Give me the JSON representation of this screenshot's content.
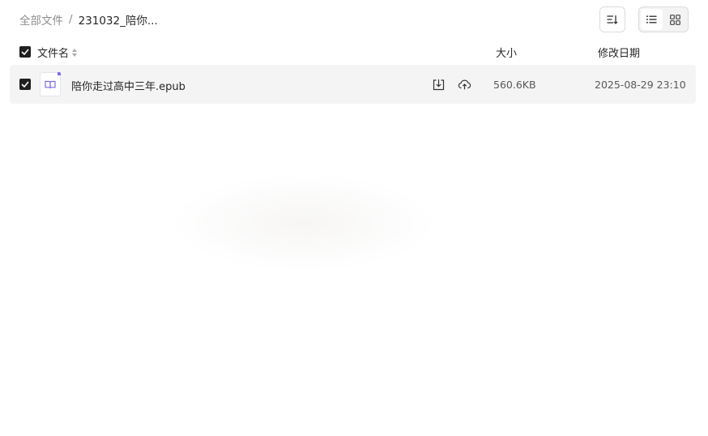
{
  "breadcrumb": {
    "root": "全部文件",
    "separator": "/",
    "current": "231032_陪你..."
  },
  "toolbar": {
    "sort_icon": "sort-descending-icon",
    "view_modes": [
      {
        "name": "list",
        "icon": "list-icon",
        "active": true
      },
      {
        "name": "grid",
        "icon": "grid-icon",
        "active": false
      }
    ]
  },
  "table": {
    "columns": {
      "name": "文件名",
      "size": "大小",
      "date": "修改日期"
    },
    "rows": [
      {
        "name": "陪你走过高中三年.epub",
        "icon": "epub-book-icon",
        "size": "560.6KB",
        "modified": "2025-08-29 23:10",
        "checked": true,
        "actions": [
          "download-icon",
          "cloud-save-icon"
        ]
      }
    ]
  },
  "colors": {
    "accent": "#7c6ee6",
    "row_bg": "#f4f4f4",
    "checkbox": "#1f1f1f"
  }
}
